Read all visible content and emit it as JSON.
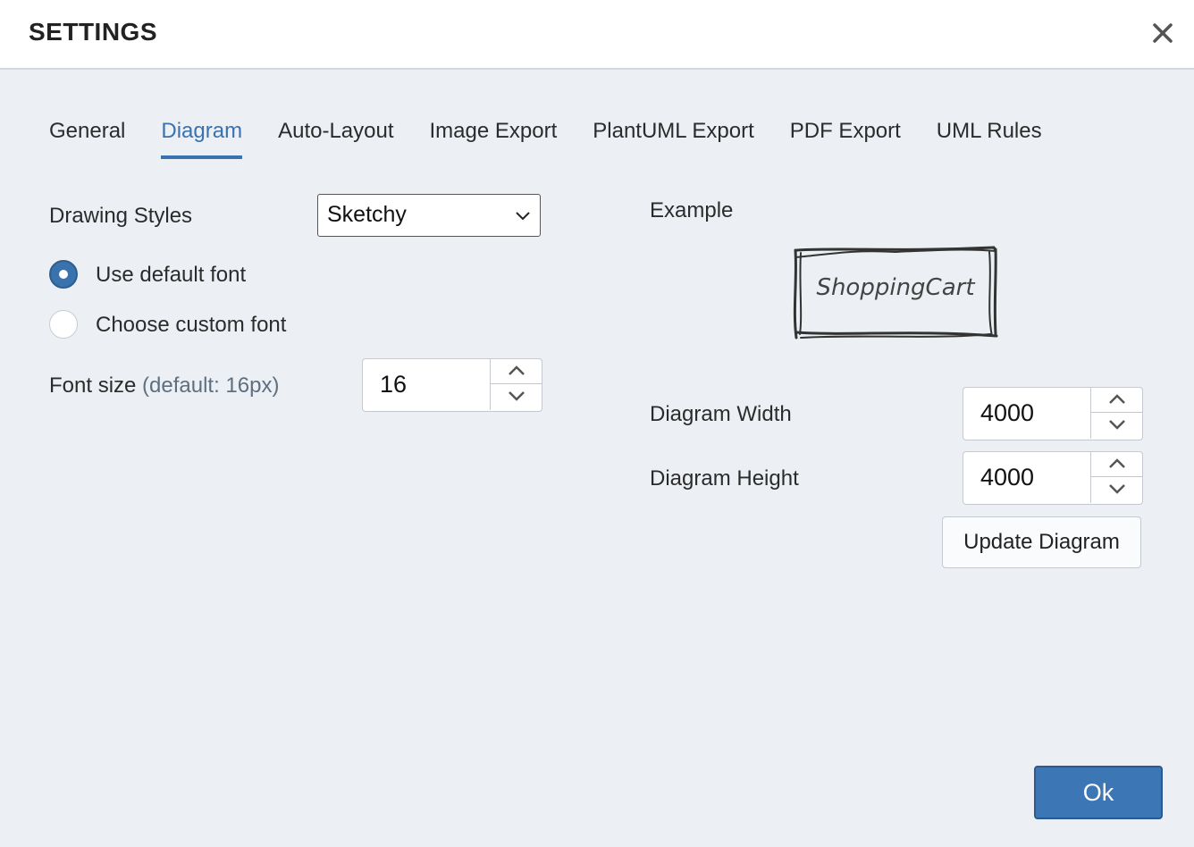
{
  "header": {
    "title": "SETTINGS"
  },
  "tabs": [
    {
      "label": "General"
    },
    {
      "label": "Diagram",
      "active": true
    },
    {
      "label": "Auto-Layout"
    },
    {
      "label": "Image Export"
    },
    {
      "label": "PlantUML Export"
    },
    {
      "label": "PDF Export"
    },
    {
      "label": "UML Rules"
    }
  ],
  "left": {
    "drawing_styles_label": "Drawing Styles",
    "drawing_style_value": "Sketchy",
    "font_option_default": "Use default font",
    "font_option_custom": "Choose custom font",
    "font_option_selected": "default",
    "font_size_label": "Font size",
    "font_size_hint": "(default: 16px)",
    "font_size_value": "16"
  },
  "right": {
    "example_label": "Example",
    "example_class_name": "ShoppingCart",
    "diagram_width_label": "Diagram Width",
    "diagram_width_value": "4000",
    "diagram_height_label": "Diagram Height",
    "diagram_height_value": "4000",
    "update_button": "Update Diagram"
  },
  "footer": {
    "ok_button": "Ok"
  },
  "colors": {
    "accent": "#3a72ad",
    "background": "#ecf0f5",
    "ok_button": "#3d76b5"
  }
}
